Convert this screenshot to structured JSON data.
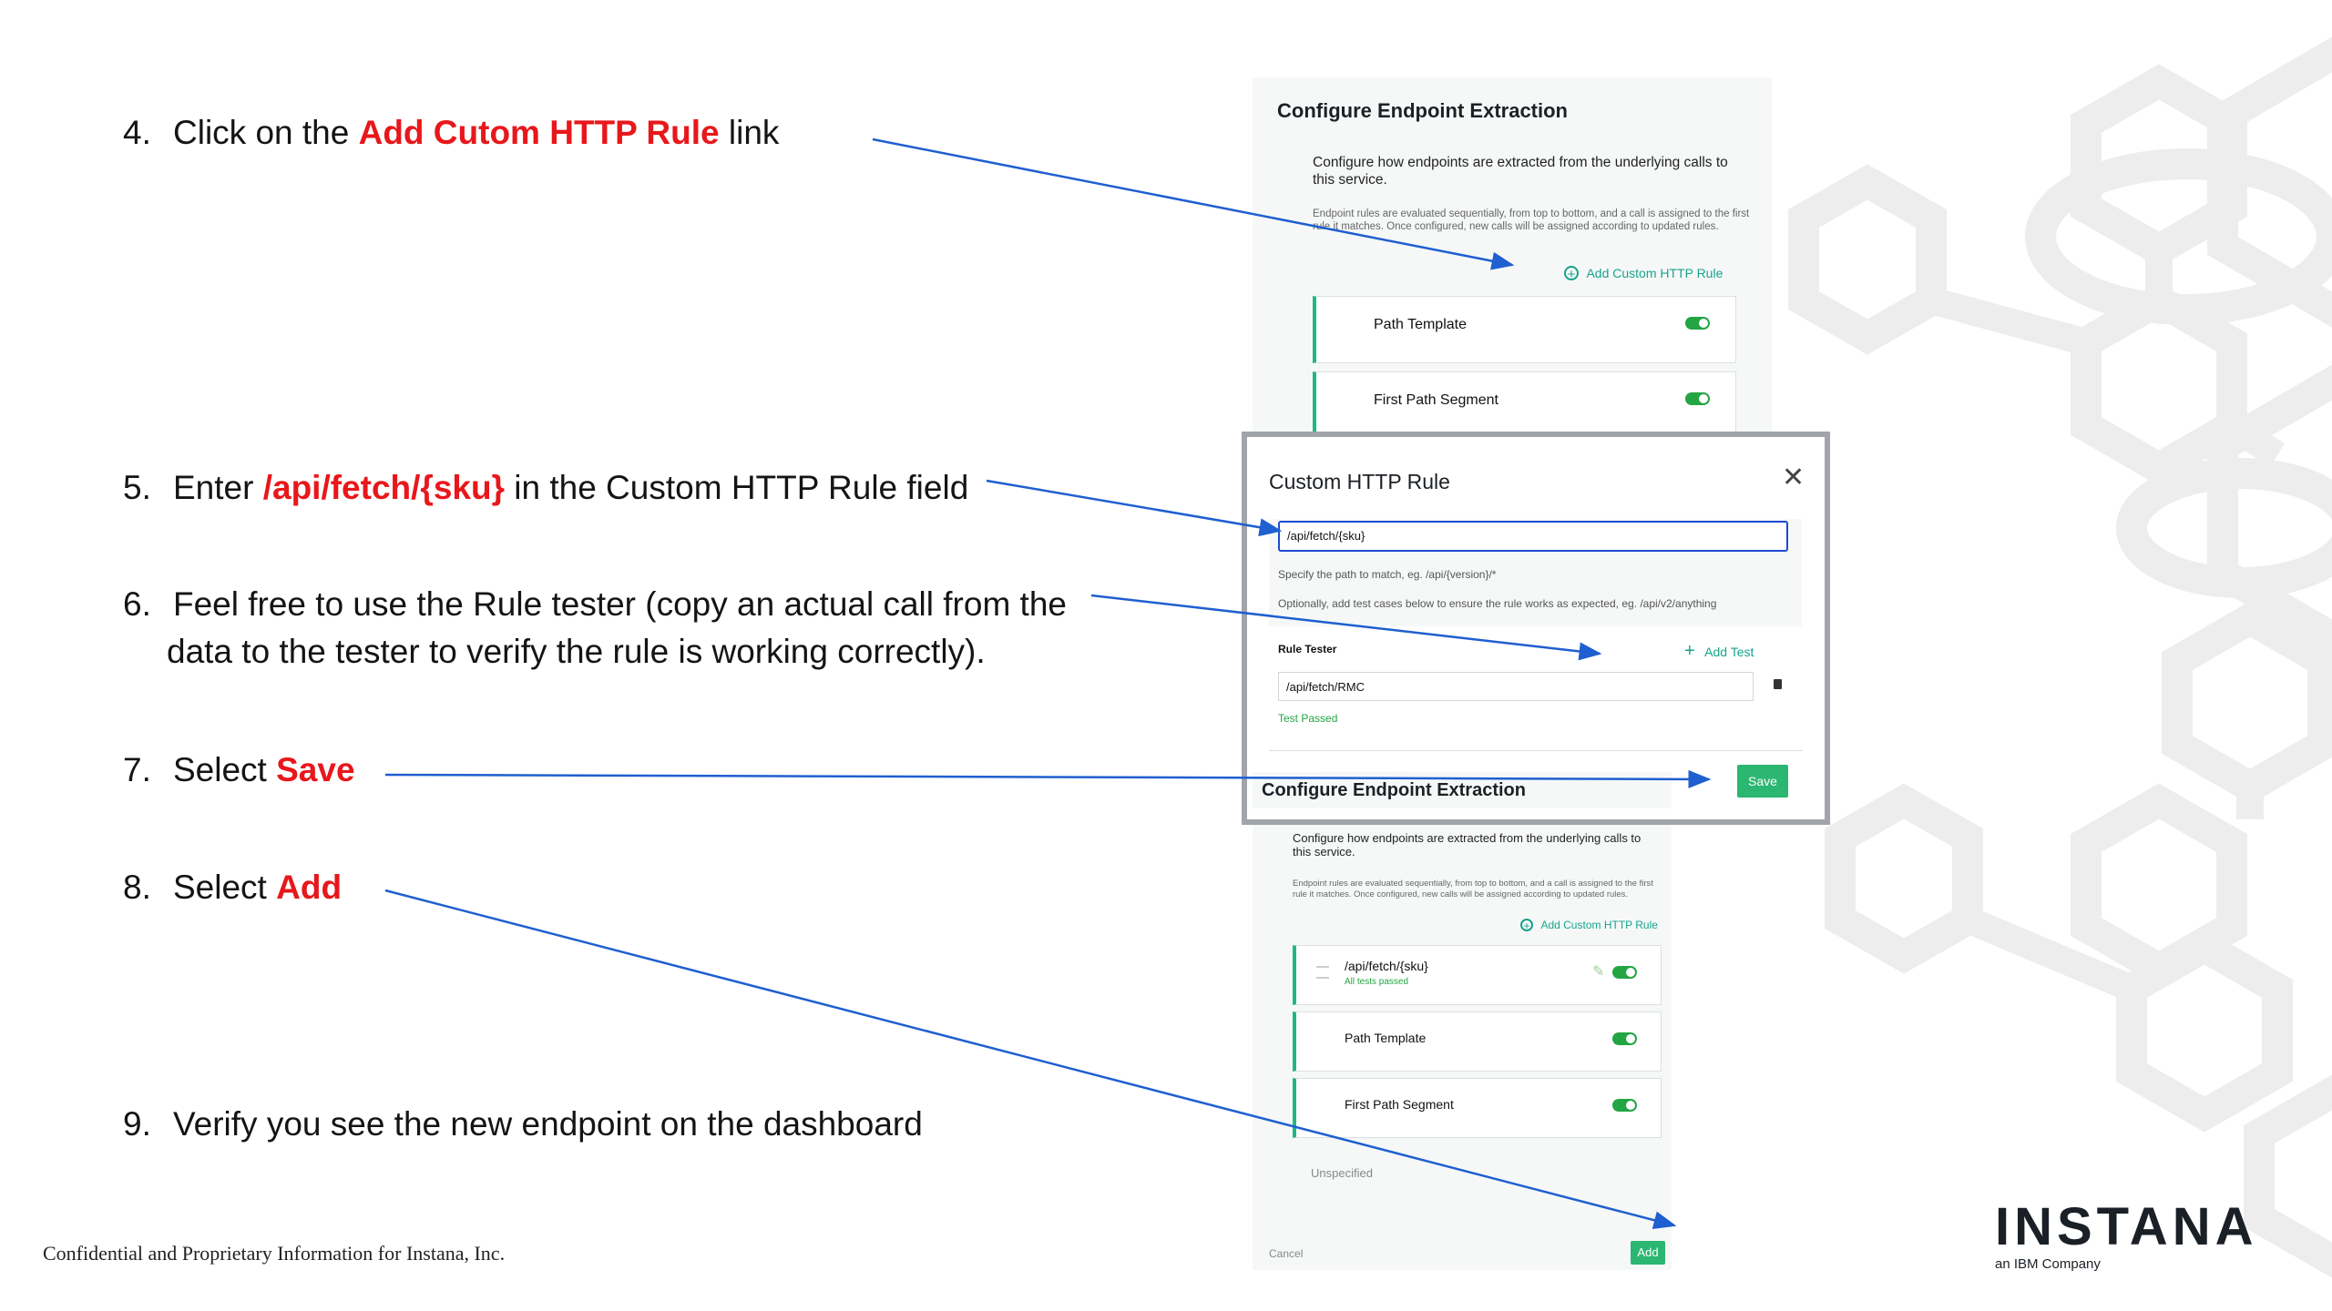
{
  "steps": [
    {
      "num": "4.",
      "pre": "Click on the ",
      "hl": "Add Cutom HTTP Rule",
      "post": " link"
    },
    {
      "num": "5.",
      "pre": "Enter ",
      "hl": "/api/fetch/{sku}",
      "post": " in the Custom HTTP Rule field"
    },
    {
      "num": "6.",
      "line1": "Feel free to use the Rule tester (copy an actual call from the",
      "line2": "data to the tester to verify the rule is working correctly)."
    },
    {
      "num": "7.",
      "pre": "Select ",
      "hl": "Save",
      "post": ""
    },
    {
      "num": "8.",
      "pre": "Select ",
      "hl": "Add",
      "post": ""
    },
    {
      "num": "9.",
      "text": "Verify you see the new endpoint on the dashboard"
    }
  ],
  "footer": "Confidential and Proprietary Information for Instana, Inc.",
  "logo": {
    "word": "INSTANA",
    "tag": "an IBM Company"
  },
  "panel1": {
    "title": "Configure Endpoint Extraction",
    "desc": "Configure how endpoints are extracted from the underlying calls to this service.",
    "note": "Endpoint rules are evaluated sequentially, from top to bottom, and a call is assigned to the first rule it matches. Once configured, new calls will be assigned according to updated rules.",
    "add_link": "Add Custom HTTP Rule",
    "rules": [
      "Path Template",
      "First Path Segment"
    ]
  },
  "modal": {
    "title": "Custom HTTP Rule",
    "input_value": "/api/fetch/{sku}",
    "hint1": "Specify the path to match, eg. /api/{version}/*",
    "hint2": "Optionally, add test cases below to ensure the rule works as expected, eg. /api/v2/anything",
    "tester_label": "Rule Tester",
    "add_test": "Add Test",
    "test_value": "/api/fetch/RMC",
    "test_status": "Test Passed",
    "save": "Save"
  },
  "panel2": {
    "title": "Configure Endpoint Extraction",
    "desc": "Configure how endpoints are extracted from the underlying calls to this service.",
    "note": "Endpoint rules are evaluated sequentially, from top to bottom, and a call is assigned to the first rule it matches. Once configured, new calls will be assigned according to updated rules.",
    "add_link": "Add Custom HTTP Rule",
    "custom_rule": "/api/fetch/{sku}",
    "custom_status": "All tests passed",
    "rules": [
      "Path Template",
      "First Path Segment"
    ],
    "unspecified": "Unspecified",
    "cancel": "Cancel",
    "add": "Add"
  },
  "colors": {
    "highlight": "#e8171b",
    "arrow": "#1f5fd0",
    "accent": "#16a38b",
    "toggle": "#23a543"
  }
}
